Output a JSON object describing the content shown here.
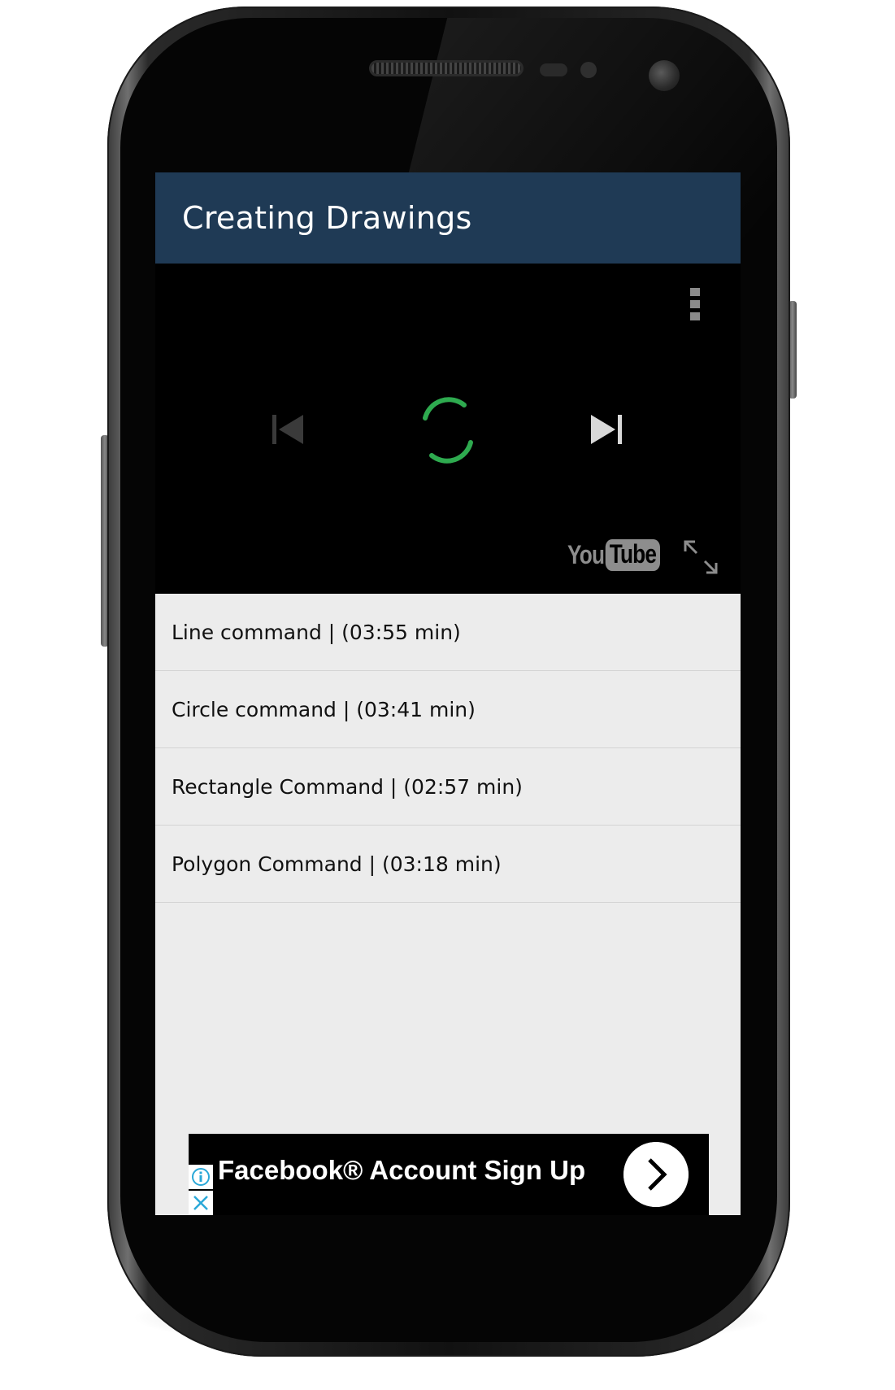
{
  "app_bar": {
    "title": "Creating Drawings",
    "color": "#1f3a55"
  },
  "player": {
    "logo_you": "You",
    "logo_tube": "Tube",
    "spinner_color": "#2eaa4f",
    "icons": [
      "more-vert-icon",
      "skip-previous-icon",
      "loading-spinner-icon",
      "skip-next-icon",
      "fullscreen-icon"
    ]
  },
  "videos": [
    {
      "label": "Line command | (03:55 min)"
    },
    {
      "label": "Circle command | (03:41 min)"
    },
    {
      "label": "Rectangle Command | (02:57 min)"
    },
    {
      "label": "Polygon Command | (03:18 min)"
    }
  ],
  "ad": {
    "text": "Facebook® Account Sign Up",
    "info_color": "#2aa8d8"
  }
}
